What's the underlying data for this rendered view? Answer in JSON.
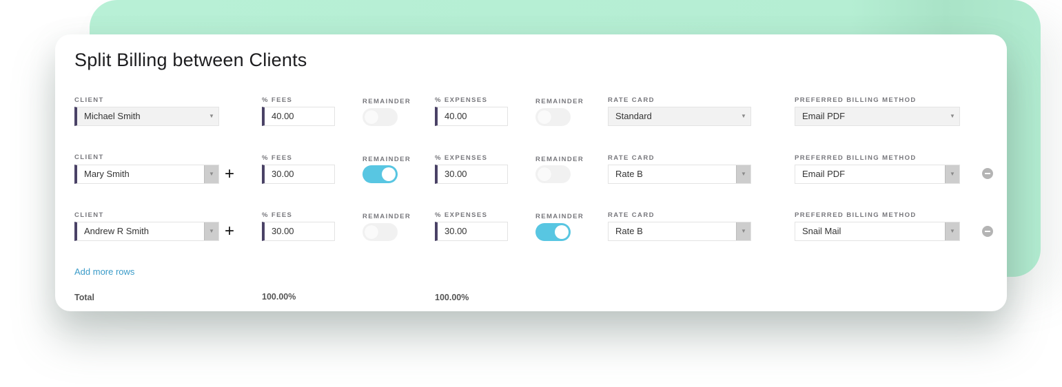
{
  "title": "Split Billing between Clients",
  "labels": {
    "client": "CLIENT",
    "fees": "% FEES",
    "remainder": "REMAINDER",
    "expenses": "% EXPENSES",
    "rate_card": "RATE CARD",
    "billing_method": "PREFERRED BILLING METHOD"
  },
  "icons": {
    "caret": "▼",
    "plus": "+",
    "remove": "remove-circle-icon"
  },
  "rows": [
    {
      "client": "Michael Smith",
      "fees": "40.00",
      "fees_remainder": false,
      "expenses": "40.00",
      "expenses_remainder": false,
      "rate_card": "Standard",
      "billing_method": "Email PDF"
    },
    {
      "client": "Mary Smith",
      "fees": "30.00",
      "fees_remainder": true,
      "expenses": "30.00",
      "expenses_remainder": false,
      "rate_card": "Rate B",
      "billing_method": "Email PDF"
    },
    {
      "client": "Andrew R Smith",
      "fees": "30.00",
      "fees_remainder": false,
      "expenses": "30.00",
      "expenses_remainder": true,
      "rate_card": "Rate B",
      "billing_method": "Snail Mail"
    }
  ],
  "add_more_rows": "Add more rows",
  "totals": {
    "label": "Total",
    "fees": "100.00%",
    "expenses": "100.00%"
  },
  "colors": {
    "accent_toggle": "#58c6e2",
    "field_marker": "#4a4266",
    "link": "#3a9bc8",
    "backdrop": "#b8f0d6"
  }
}
